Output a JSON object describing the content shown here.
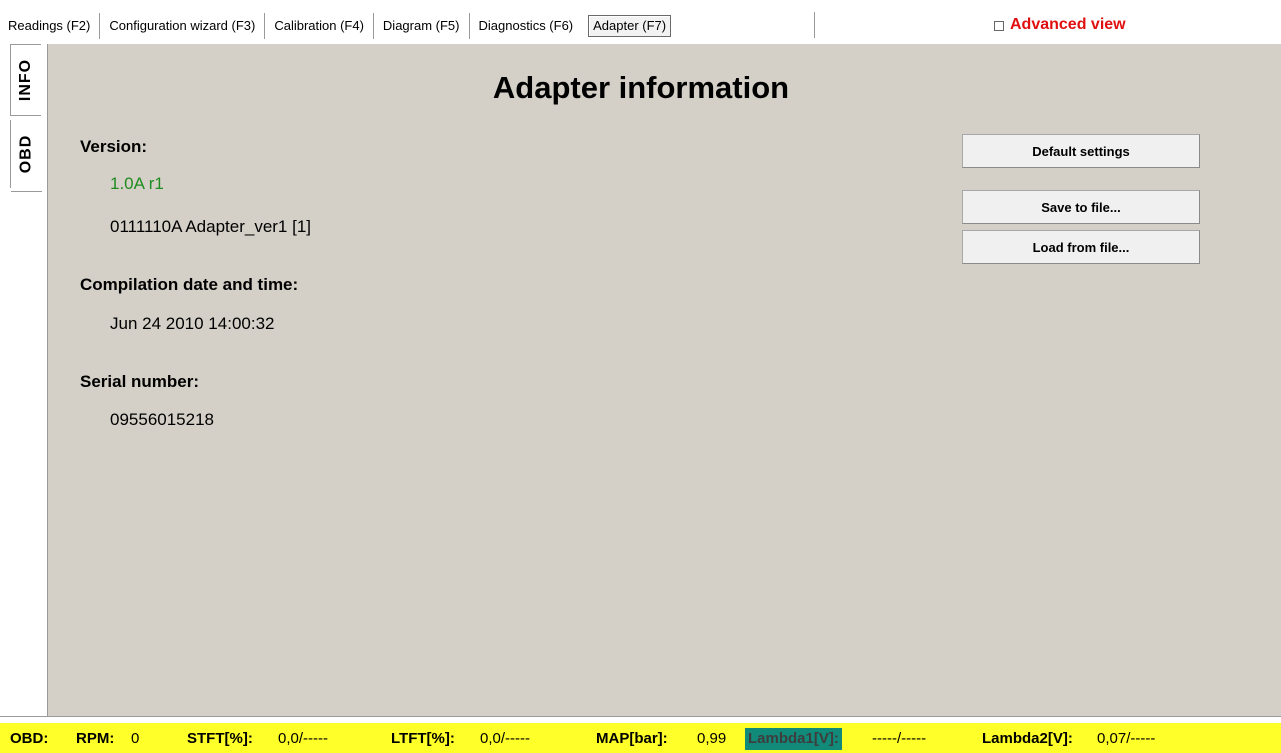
{
  "tabs": [
    {
      "label": "Readings (F2)"
    },
    {
      "label": "Configuration wizard (F3)"
    },
    {
      "label": "Calibration (F4)"
    },
    {
      "label": "Diagram (F5)"
    },
    {
      "label": "Diagnostics (F6)"
    },
    {
      "label": "Adapter (F7)",
      "active": true
    }
  ],
  "advanced_view": {
    "label": "Advanced view",
    "checked": false,
    "color": "#e01010"
  },
  "side_tabs": [
    {
      "label": "INFO",
      "active": true
    },
    {
      "label": "OBD",
      "active": false
    }
  ],
  "main": {
    "title": "Adapter information",
    "version": {
      "label": "Version:",
      "value1": "1.0A r1",
      "value2": "0111110A Adapter_ver1 [1]"
    },
    "compilation": {
      "label": "Compilation date and time:",
      "value": "Jun 24 2010 14:00:32"
    },
    "serial": {
      "label": "Serial number:",
      "value": "09556015218"
    },
    "buttons": {
      "default": "Default settings",
      "save": "Save to file...",
      "load": "Load from file..."
    }
  },
  "status": {
    "obd": "OBD:",
    "rpm_label": "RPM:",
    "rpm_value": "0",
    "stft_label": "STFT[%]:",
    "stft_value": "0,0/-----",
    "ltft_label": "LTFT[%]:",
    "ltft_value": "0,0/-----",
    "map_label": "MAP[bar]:",
    "map_value": "0,99",
    "lambda1_label": "Lambda1[V]:",
    "lambda1_value": "-----/-----",
    "lambda2_label": "Lambda2[V]:",
    "lambda2_value": "0,07/-----",
    "bar_color": "#ffff29",
    "highlight_color": "#118a7a"
  }
}
